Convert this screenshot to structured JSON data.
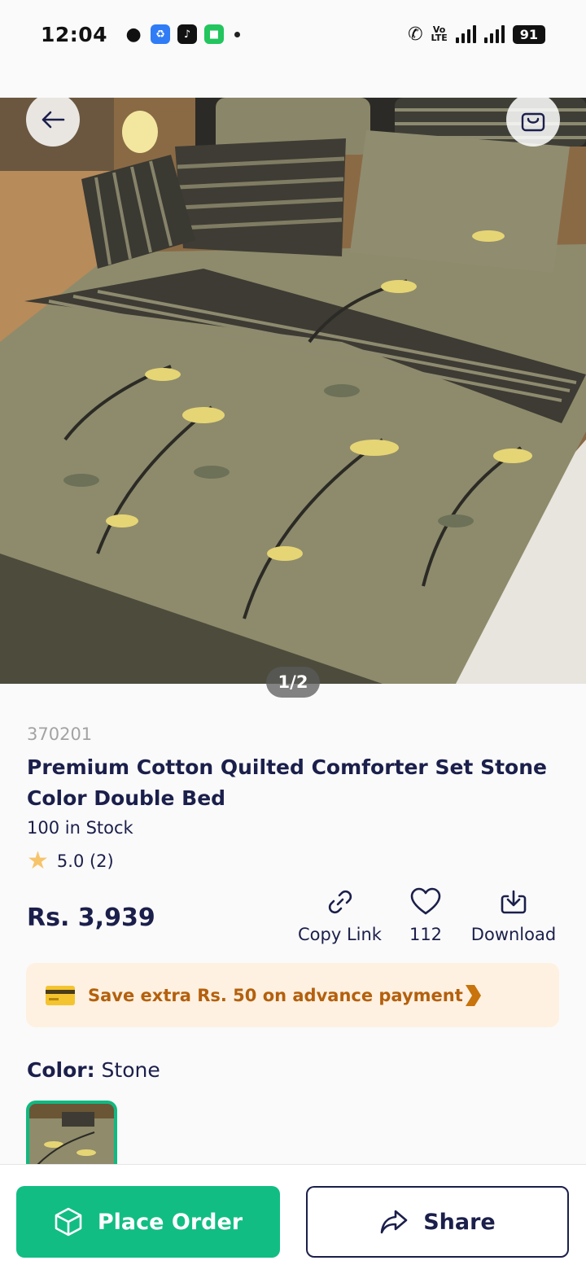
{
  "status_bar": {
    "time": "12:04",
    "volte_top": "Vo",
    "volte_bottom": "LTE",
    "battery": "91"
  },
  "gallery": {
    "counter": "1/2"
  },
  "product": {
    "sku": "370201",
    "title": "Premium Cotton Quilted Comforter Set Stone Color Double Bed",
    "stock": "100 in Stock",
    "rating": "5.0 (2)",
    "price": "Rs. 3,939"
  },
  "actions": {
    "copy_link": "Copy Link",
    "likes": "112",
    "download": "Download"
  },
  "offer": {
    "text": "Save extra Rs. 50 on advance payment"
  },
  "color": {
    "label": "Color:",
    "value": "Stone"
  },
  "bottom_bar": {
    "place_order": "Place Order",
    "share": "Share"
  },
  "colors": {
    "primary_green": "#11bd83",
    "navy": "#1b1f4b",
    "offer_bg": "#fef1e1",
    "offer_text": "#b4600d"
  }
}
